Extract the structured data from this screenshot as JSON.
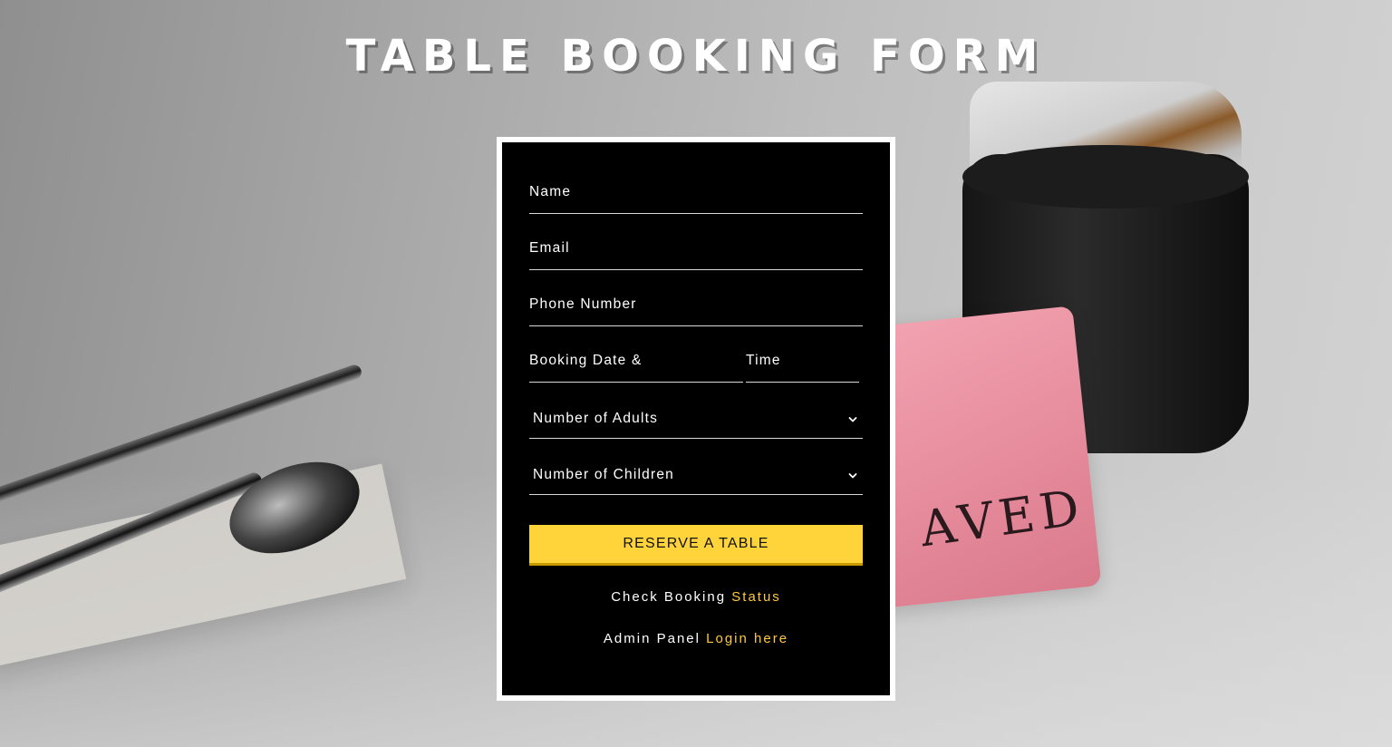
{
  "page": {
    "title": "TABLE BOOKING FORM"
  },
  "form": {
    "name_label": "Name",
    "email_label": "Email",
    "phone_label": "Phone Number",
    "date_label": "Booking Date &",
    "time_label": "Time",
    "adults_label": "Number of Adults",
    "children_label": "Number of Children",
    "reserve_button": "RESERVE A TABLE"
  },
  "links": {
    "status_prefix": "Check Booking",
    "status_link": "Status",
    "admin_prefix": "Admin Panel",
    "admin_link": "Login here"
  },
  "background": {
    "sign_text": "AVED"
  },
  "colors": {
    "accent": "#ffd43b",
    "link": "#ffc83d",
    "card": "#000000"
  },
  "icons": {
    "select_arrow": "chevron-down-icon"
  }
}
